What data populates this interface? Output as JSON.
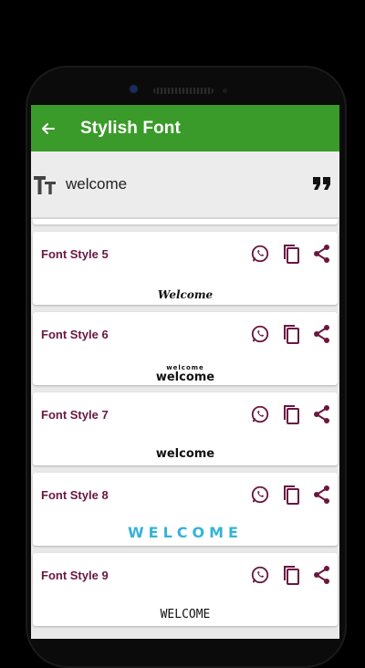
{
  "app": {
    "title": "Stylish Font",
    "accent": "#3a9b2a",
    "title_color": "#6b1740"
  },
  "input": {
    "value": "welcome"
  },
  "icons": {
    "back": "arrow-left-icon",
    "text": "text-size-icon",
    "quote": "quote-icon",
    "whatsapp": "whatsapp-icon",
    "copy": "copy-icon",
    "share": "share-icon"
  },
  "cards": [
    {
      "label": "Font Style 5",
      "sample": "Welcome"
    },
    {
      "label": "Font Style 6",
      "sample_top": "welcome",
      "sample": "welcome"
    },
    {
      "label": "Font Style 7",
      "sample": "welcome"
    },
    {
      "label": "Font Style 8",
      "sample": "WELCOME"
    },
    {
      "label": "Font Style 9",
      "sample": "WELCOME"
    }
  ]
}
